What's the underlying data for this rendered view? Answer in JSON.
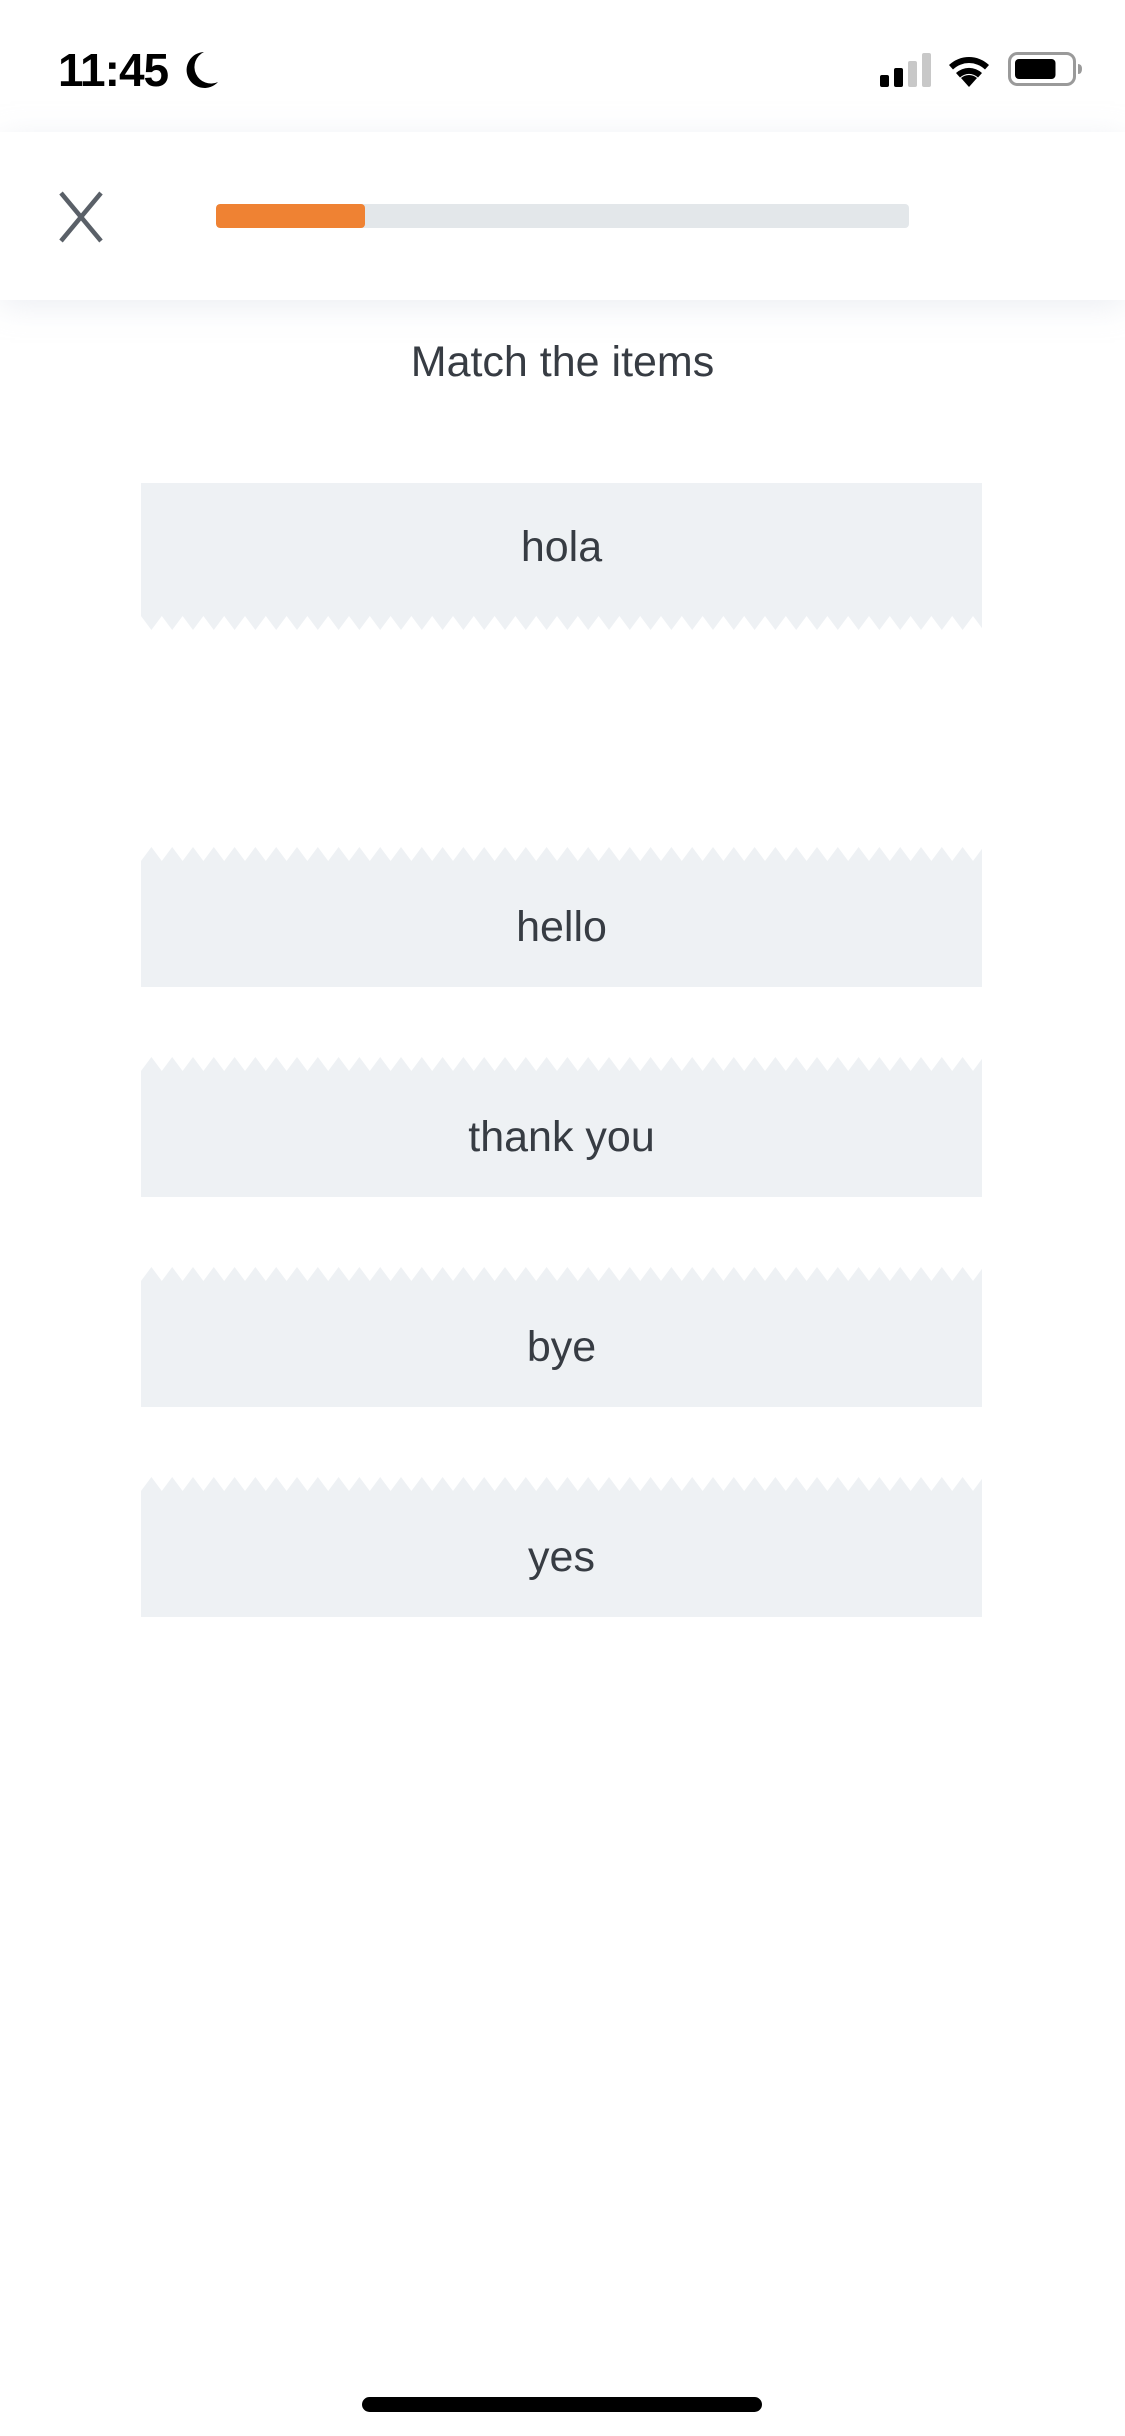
{
  "status_bar": {
    "time": "11:45",
    "focus_icon": "moon-icon",
    "signal_bars_filled": 2,
    "signal_bars_total": 4,
    "wifi_icon": "wifi-icon",
    "battery_level_percent": 75
  },
  "header": {
    "close_icon": "close-icon",
    "progress_percent": 21.5,
    "progress_color": "#ef8233",
    "progress_track_color": "#e3e7ea"
  },
  "exercise": {
    "instructions": "Match the items",
    "prompt": {
      "label": "hola"
    },
    "answers": [
      {
        "label": "hello"
      },
      {
        "label": "thank you"
      },
      {
        "label": "bye"
      },
      {
        "label": "yes"
      }
    ],
    "card_color": "#eef1f4",
    "text_color": "#373c43"
  }
}
